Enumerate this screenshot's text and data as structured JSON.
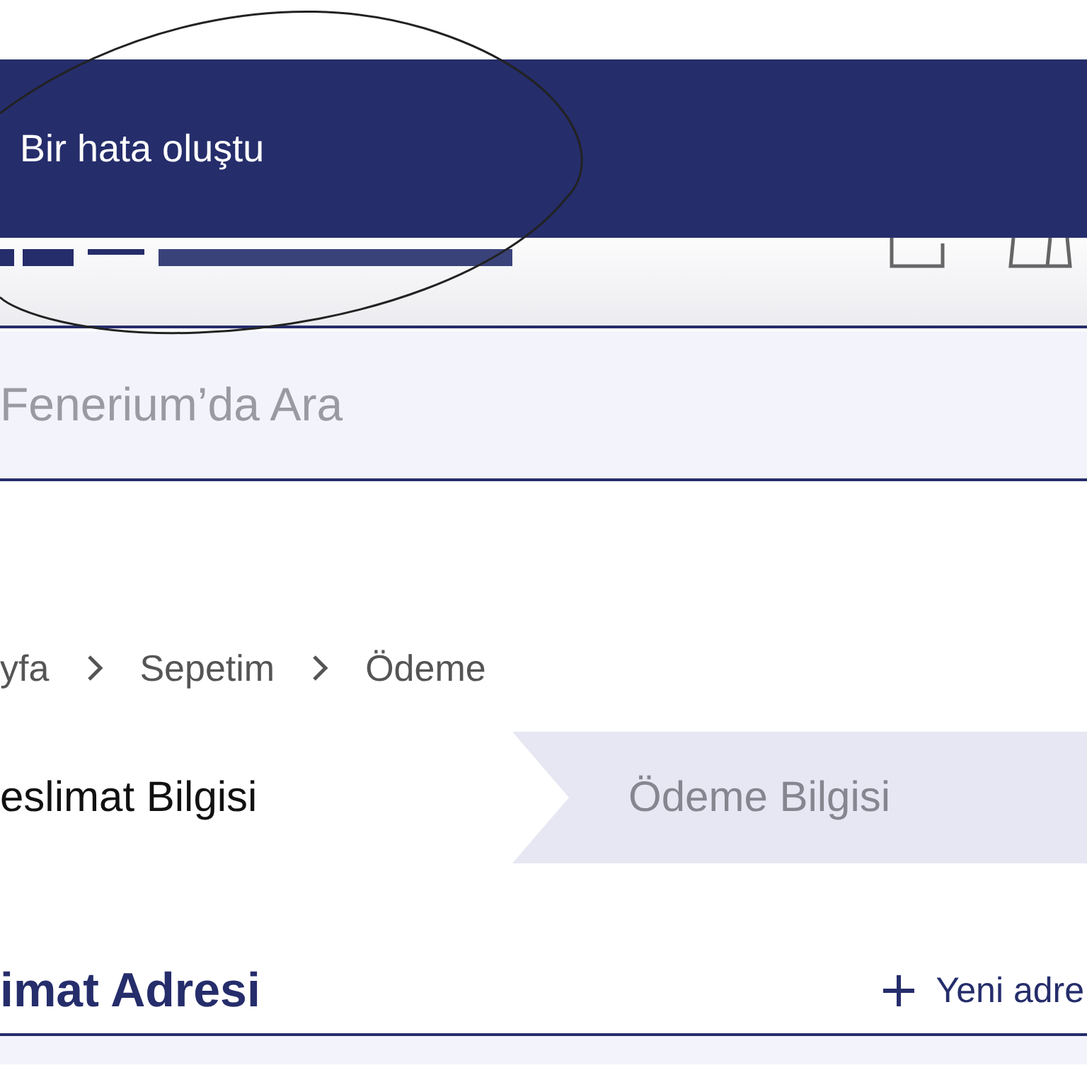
{
  "toast": {
    "message": "Bir hata oluştu"
  },
  "search": {
    "placeholder": "Fenerium’da Ara"
  },
  "breadcrumb": [
    "yfa",
    "Sepetim",
    "Ödeme"
  ],
  "steps": [
    {
      "label": "eslimat Bilgisi",
      "selected": true
    },
    {
      "label": "Ödeme Bilgisi",
      "selected": false
    }
  ],
  "section": {
    "title": "imat Adresi",
    "action": "Yeni adre"
  }
}
